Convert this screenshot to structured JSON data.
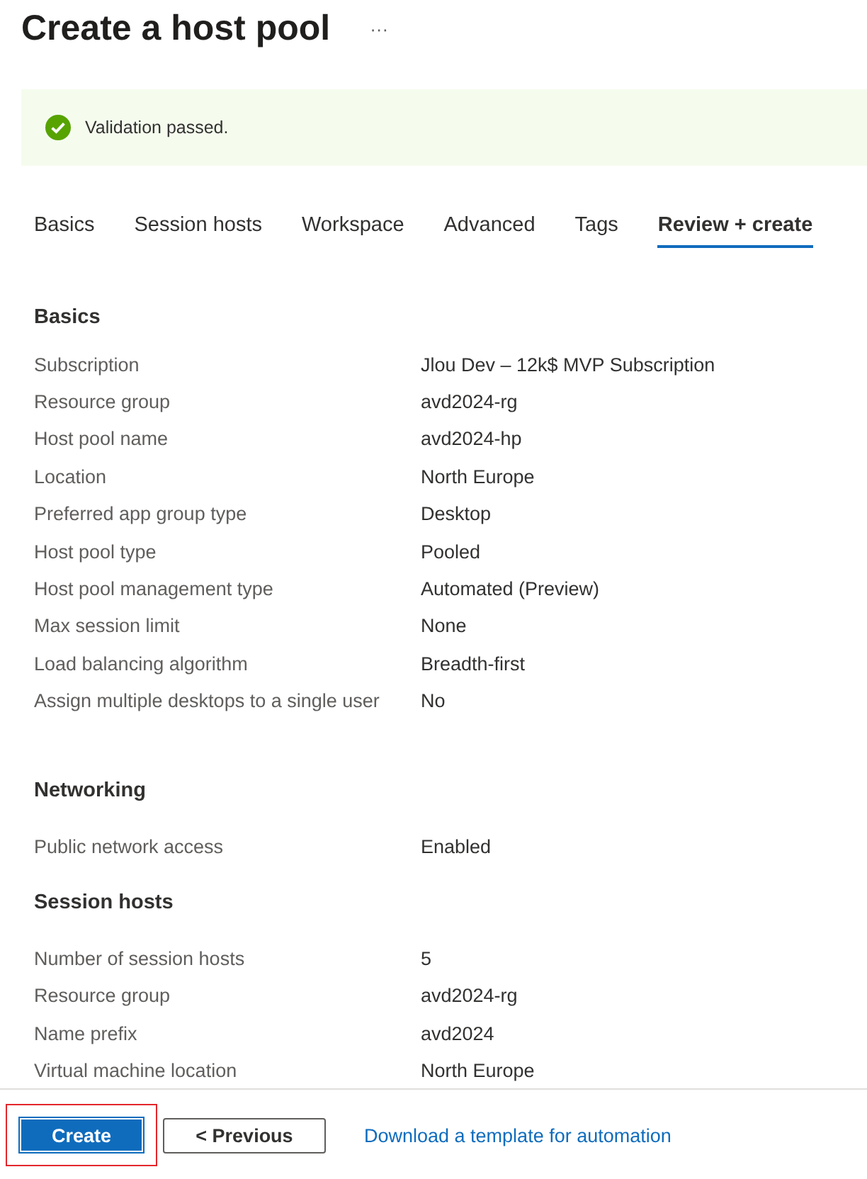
{
  "page": {
    "title": "Create a host pool",
    "more": "···"
  },
  "banner": {
    "passed": true,
    "message": "Validation passed."
  },
  "tabs": [
    {
      "label": "Basics",
      "selected": false
    },
    {
      "label": "Session hosts",
      "selected": false
    },
    {
      "label": "Workspace",
      "selected": false
    },
    {
      "label": "Advanced",
      "selected": false
    },
    {
      "label": "Tags",
      "selected": false
    },
    {
      "label": "Review + create",
      "selected": true
    }
  ],
  "sections": [
    {
      "heading": "Basics",
      "rows": [
        {
          "label": "Subscription",
          "value": "Jlou Dev – 12k$ MVP Subscription"
        },
        {
          "label": "Resource group",
          "value": "avd2024-rg"
        },
        {
          "label": "Host pool name",
          "value": "avd2024-hp"
        },
        {
          "label": "Location",
          "value": "North Europe"
        },
        {
          "label": "Preferred app group type",
          "value": "Desktop"
        },
        {
          "label": "Host pool type",
          "value": "Pooled"
        },
        {
          "label": "Host pool management type",
          "value": "Automated (Preview)"
        },
        {
          "label": "Max session limit",
          "value": "None"
        },
        {
          "label": "Load balancing algorithm",
          "value": "Breadth-first"
        },
        {
          "label": "Assign multiple desktops to a single user",
          "value": "No"
        }
      ]
    },
    {
      "heading": "Networking",
      "rows": [
        {
          "label": "Public network access",
          "value": "Enabled"
        }
      ]
    },
    {
      "heading": "Session hosts",
      "rows": [
        {
          "label": "Number of session hosts",
          "value": "5"
        },
        {
          "label": "Resource group",
          "value": "avd2024-rg"
        },
        {
          "label": "Name prefix",
          "value": "avd2024"
        },
        {
          "label": "Virtual machine location",
          "value": "North Europe"
        }
      ]
    }
  ],
  "footer": {
    "create": {
      "label": "Create",
      "highlighted": true
    },
    "previous": "< Previous",
    "download_link": "Download a template for automation"
  }
}
